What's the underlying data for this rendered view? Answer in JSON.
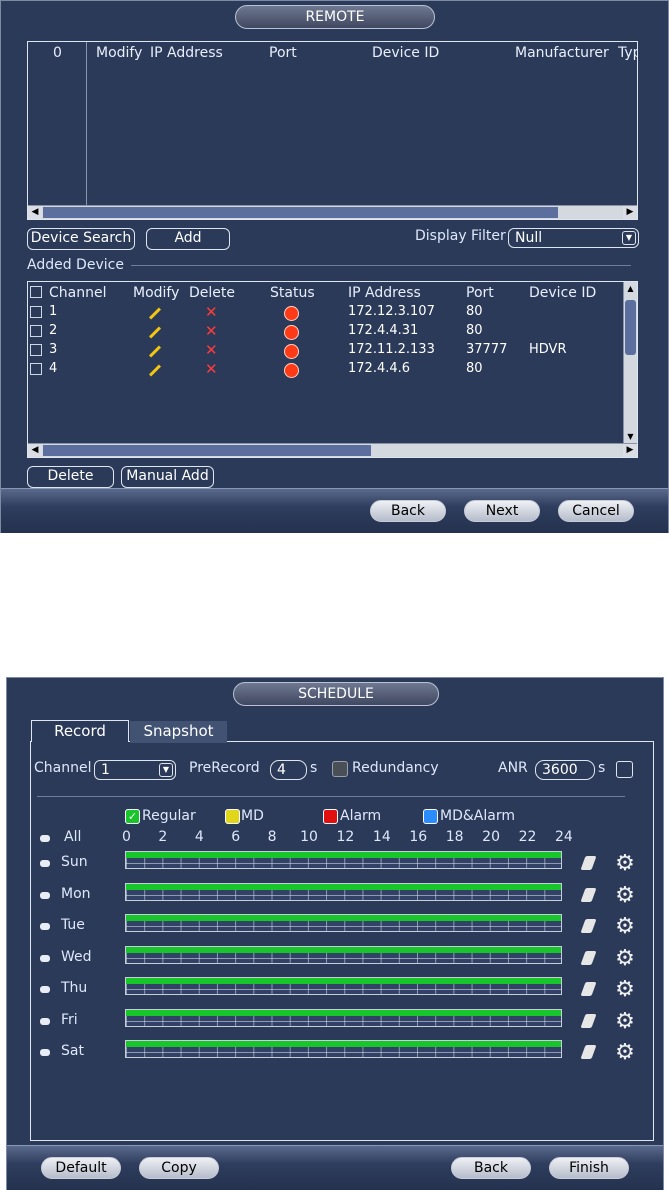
{
  "remote": {
    "title": "REMOTE",
    "search_table": {
      "headers": [
        "0",
        "Modify",
        "IP Address",
        "Port",
        "Device ID",
        "Manufacturer",
        "Typ"
      ]
    },
    "device_search_label": "Device Search",
    "add_label": "Add",
    "display_filter_label": "Display Filter",
    "display_filter_value": "Null",
    "added_device_label": "Added Device",
    "added_table": {
      "headers": [
        "Channel",
        "Modify",
        "Delete",
        "Status",
        "IP Address",
        "Port",
        "Device ID"
      ],
      "rows": [
        {
          "channel": "1",
          "ip": "172.12.3.107",
          "port": "80",
          "device_id": ""
        },
        {
          "channel": "2",
          "ip": "172.4.4.31",
          "port": "80",
          "device_id": ""
        },
        {
          "channel": "3",
          "ip": "172.11.2.133",
          "port": "37777",
          "device_id": "HDVR"
        },
        {
          "channel": "4",
          "ip": "172.4.4.6",
          "port": "80",
          "device_id": ""
        }
      ]
    },
    "delete_label": "Delete",
    "manual_add_label": "Manual Add",
    "back_label": "Back",
    "next_label": "Next",
    "cancel_label": "Cancel",
    "icons": {
      "modify": "pencil-icon",
      "delete": "x-icon",
      "status": "status-dot-icon"
    },
    "colors": {
      "status_dot": "#ff3a17",
      "pencil": "#f3c510",
      "delete": "#ff3b3b"
    }
  },
  "schedule": {
    "title": "SCHEDULE",
    "tabs": [
      {
        "label": "Record"
      },
      {
        "label": "Snapshot"
      }
    ],
    "channel_label": "Channel",
    "channel_value": "1",
    "prerecord_label": "PreRecord",
    "prerecord_value": "4",
    "prerecord_unit": "s",
    "redundancy_label": "Redundancy",
    "anr_label": "ANR",
    "anr_value": "3600",
    "anr_unit": "s",
    "legend": [
      {
        "label": "Regular",
        "color": "#18c52a",
        "checked": true
      },
      {
        "label": "MD",
        "color": "#e0d71a",
        "checked": false
      },
      {
        "label": "Alarm",
        "color": "#e01010",
        "checked": false
      },
      {
        "label": "MD&Alarm",
        "color": "#2a8cff",
        "checked": false
      }
    ],
    "all_label": "All",
    "hours": [
      "0",
      "2",
      "4",
      "6",
      "8",
      "10",
      "12",
      "14",
      "16",
      "18",
      "20",
      "22",
      "24"
    ],
    "days": [
      {
        "label": "Sun",
        "regular_fraction": 1.0
      },
      {
        "label": "Mon",
        "regular_fraction": 1.0
      },
      {
        "label": "Tue",
        "regular_fraction": 1.0
      },
      {
        "label": "Wed",
        "regular_fraction": 1.0
      },
      {
        "label": "Thu",
        "regular_fraction": 1.0
      },
      {
        "label": "Fri",
        "regular_fraction": 1.0
      },
      {
        "label": "Sat",
        "regular_fraction": 1.0
      }
    ],
    "default_label": "Default",
    "copy_label": "Copy",
    "back_label": "Back",
    "finish_label": "Finish",
    "icons": {
      "copy_row": "brush-icon",
      "settings": "gear-icon"
    }
  }
}
